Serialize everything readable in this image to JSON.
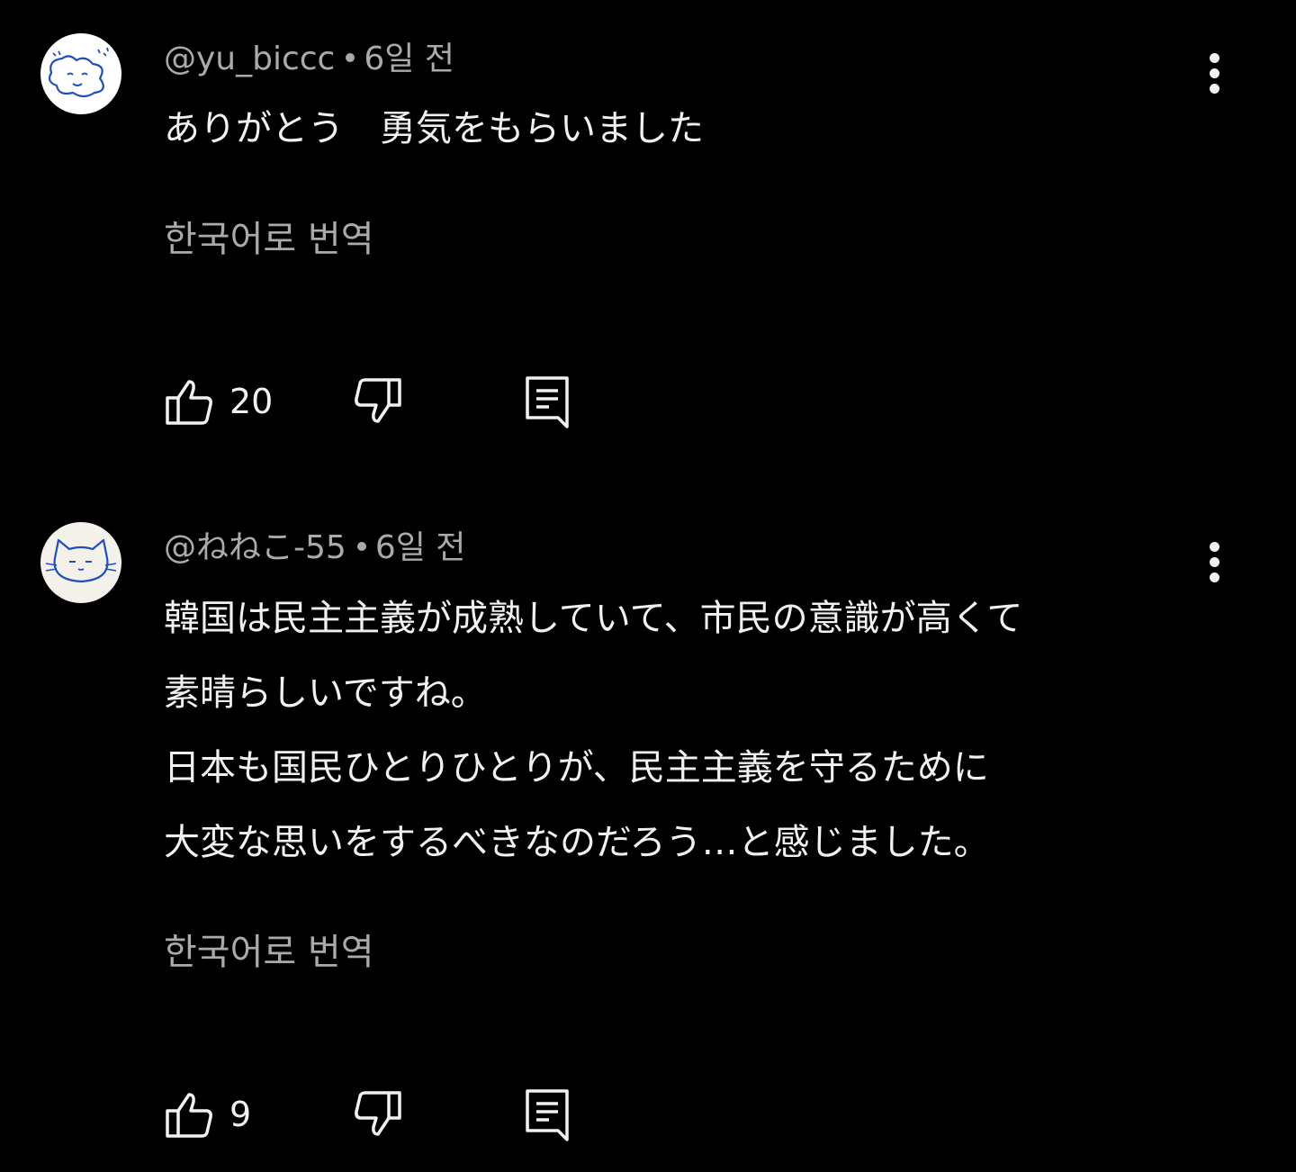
{
  "theme": {
    "background": "#000000",
    "text_primary": "#f1f1f1",
    "text_secondary": "#aaaaaa",
    "avatar_bg": "#ffffff",
    "avatar2_bg": "#f3f1ea",
    "avatar_ink": "#1f4fbf"
  },
  "comments": [
    {
      "author": "@yu_biccc",
      "time": "6일 전",
      "lines": [
        "ありがとう　勇気をもらいました"
      ],
      "translate_label": "한국어로 번역",
      "likes": "20",
      "avatar_icon": "star-blob-avatar-icon",
      "more_icon": "more-vert-icon"
    },
    {
      "author": "@ねねこ-55",
      "time": "6일 전",
      "lines": [
        "韓国は民主主義が成熟していて、市民の意識が高くて",
        "素晴らしいですね。",
        "日本も国民ひとりひとりが、民主主義を守るために",
        "大変な思いをするべきなのだろう…と感じました。"
      ],
      "translate_label": "한국어로 번역",
      "likes": "9",
      "avatar_icon": "cat-avatar-icon",
      "more_icon": "more-vert-icon"
    }
  ]
}
